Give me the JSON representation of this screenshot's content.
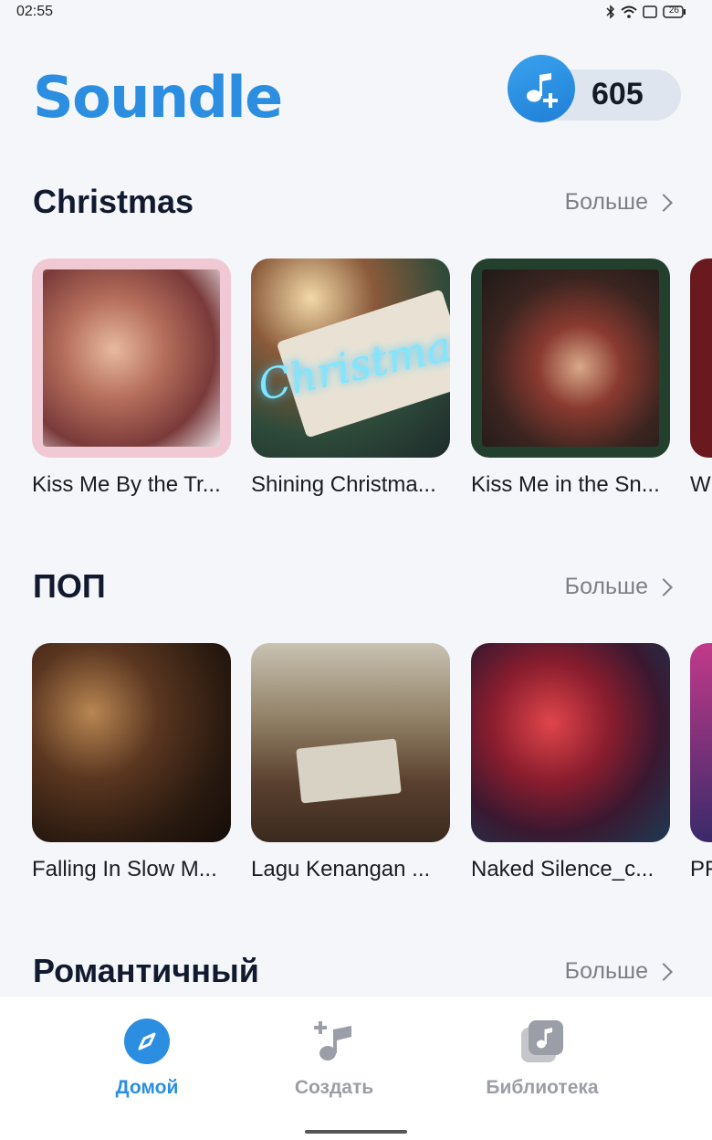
{
  "status_bar": {
    "time": "02:55",
    "battery": "26"
  },
  "header": {
    "logo": "Soundle",
    "credits": "605"
  },
  "sections": [
    {
      "title": "Christmas",
      "more": "Больше",
      "cards": [
        {
          "title": "Kiss Me By the Tr..."
        },
        {
          "title": "Shining Christma..."
        },
        {
          "title": "Kiss Me in the Sn..."
        },
        {
          "title": "W"
        }
      ]
    },
    {
      "title": "ПОП",
      "more": "Больше",
      "cards": [
        {
          "title": "Falling In Slow M..."
        },
        {
          "title": "Lagu Kenangan ..."
        },
        {
          "title": "Naked Silence_c..."
        },
        {
          "title": "PF"
        }
      ]
    },
    {
      "title": "Романтичный",
      "more": "Больше"
    }
  ],
  "covers": {
    "neon_text": "Christmas"
  },
  "bottom_nav": {
    "items": [
      {
        "label": "Домой",
        "icon": "compass-icon",
        "active": true
      },
      {
        "label": "Создать",
        "icon": "music-add-icon",
        "active": false
      },
      {
        "label": "Библиотека",
        "icon": "library-icon",
        "active": false
      }
    ]
  },
  "colors": {
    "accent": "#2c8ee0",
    "background": "#f5f6f9",
    "text": "#111a2e",
    "muted": "#7c7f86"
  }
}
